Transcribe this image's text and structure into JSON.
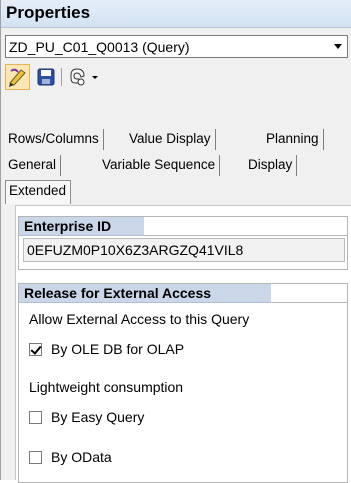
{
  "title": "Properties",
  "query_selector": {
    "value": "ZD_PU_C01_Q0013 (Query)"
  },
  "toolbar": {
    "icons": [
      "edit-icon",
      "save-icon",
      "tech-name-icon",
      "dropdown-arrow-icon"
    ]
  },
  "tabs": [
    {
      "label": "Rows/Columns"
    },
    {
      "label": "Value Display"
    },
    {
      "label": "Planning"
    },
    {
      "label": "General"
    },
    {
      "label": "Variable Sequence"
    },
    {
      "label": "Display"
    },
    {
      "label": "Extended"
    }
  ],
  "enterprise_id": {
    "header": "Enterprise ID",
    "value": "0EFUZM0P10X6Z3ARGZQ41VIL8"
  },
  "release": {
    "header": "Release for External Access",
    "allow_label": "Allow External Access to this Query",
    "ole_db": {
      "label": "By OLE DB for OLAP",
      "checked": true
    },
    "lightweight_label": "Lightweight consumption",
    "easy_query": {
      "label": "By Easy Query",
      "checked": false
    },
    "odata": {
      "label": "By OData",
      "checked": false
    }
  }
}
